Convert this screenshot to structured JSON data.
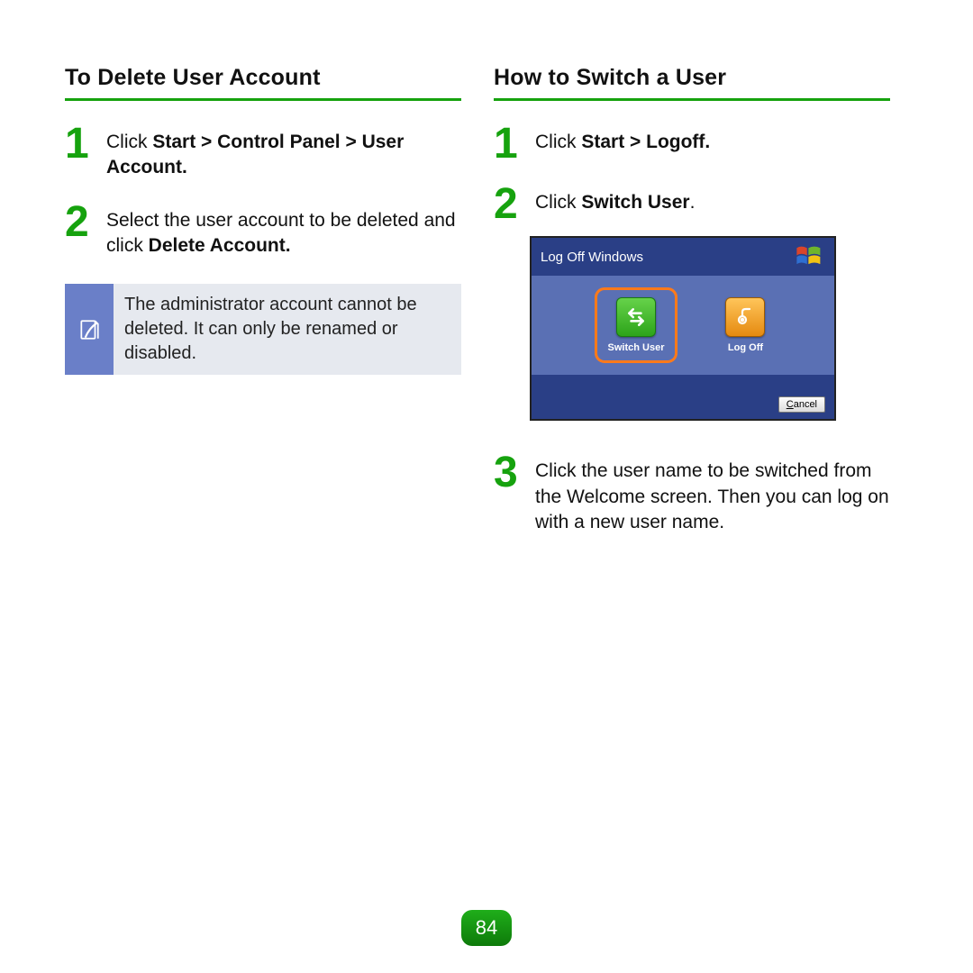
{
  "left": {
    "heading": "To Delete User Account",
    "step1_prefix": "Click ",
    "step1_bold": "Start > Control Panel > User Account.",
    "step2_prefix": "Select the user account to be deleted and click ",
    "step2_bold": "Delete Account.",
    "note": "The administrator account cannot be deleted. It can only be renamed or disabled."
  },
  "right": {
    "heading": "How to Switch a User",
    "step1_prefix": "Click ",
    "step1_bold": "Start > Logoff.",
    "step2_prefix": "Click ",
    "step2_bold": "Switch User",
    "step2_suffix": ".",
    "step3": "Click the user name to be switched from the Welcome screen. Then you can log on with a new user name."
  },
  "dialog": {
    "title": "Log Off Windows",
    "switch_label": "Switch User",
    "logoff_label": "Log Off",
    "cancel_rest": "ancel",
    "cancel_u": "C"
  },
  "page_number": "84"
}
